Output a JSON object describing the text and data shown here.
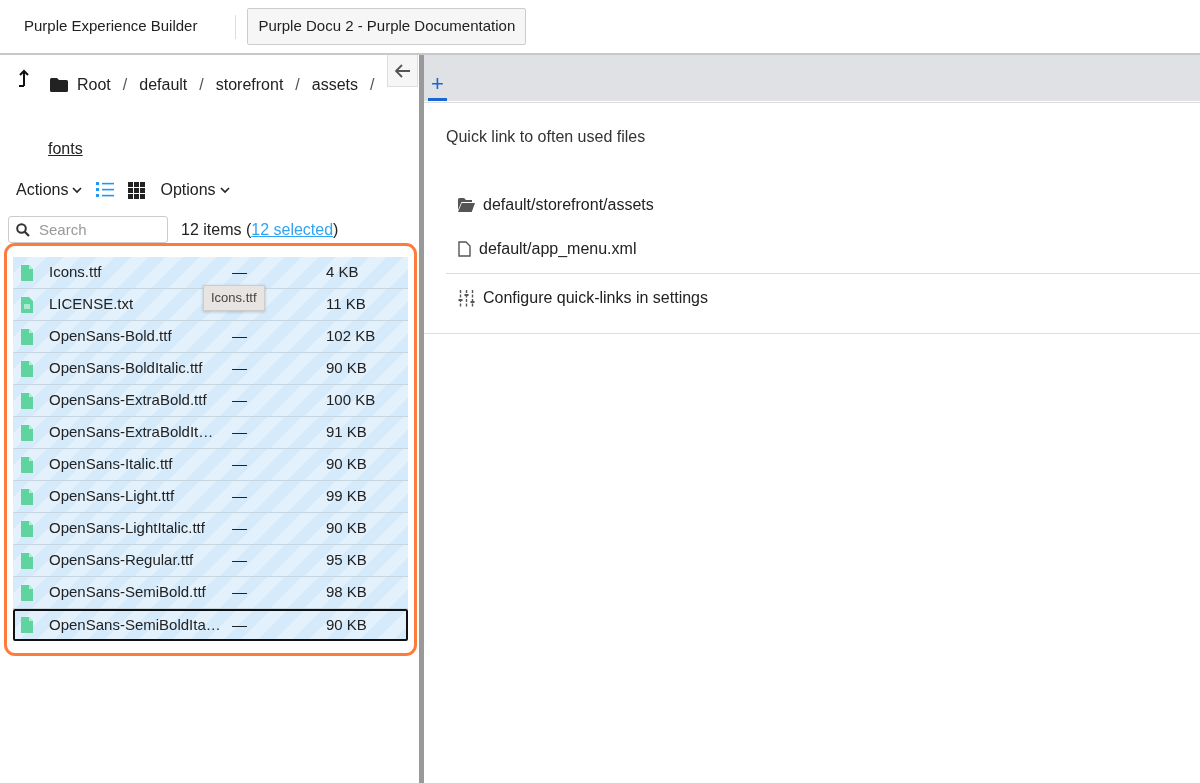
{
  "header": {
    "app_title": "Purple Experience Builder",
    "project_button": "Purple Docu 2 - Purple Documentation"
  },
  "breadcrumb": {
    "items": [
      {
        "label": "Root",
        "separator": "/"
      },
      {
        "label": "default",
        "separator": "/"
      },
      {
        "label": "storefront",
        "separator": "/"
      },
      {
        "label": "assets",
        "separator": "/"
      }
    ],
    "current": "fonts"
  },
  "toolbar": {
    "actions": "Actions",
    "view_modes": [
      {
        "kind": "list",
        "selected": true
      },
      {
        "kind": "grid",
        "selected": false
      }
    ],
    "options": "Options"
  },
  "search": {
    "placeholder": "Search"
  },
  "summary": {
    "count": "12 items",
    "open": "(",
    "selection": "12 selected",
    "close": ")"
  },
  "files": [
    {
      "name": "Icons.ttf",
      "status": "—",
      "size": "4 KB",
      "kind": "font",
      "selected": true,
      "focused": false
    },
    {
      "name": "LICENSE.txt",
      "size": "11 KB",
      "kind": "text",
      "selected": true,
      "focused": false
    },
    {
      "name": "OpenSans-Bold.ttf",
      "status": "—",
      "size": "102 KB",
      "kind": "font",
      "selected": true,
      "focused": false
    },
    {
      "name": "OpenSans-BoldItalic.ttf",
      "status": "—",
      "size": "90 KB",
      "kind": "font",
      "selected": true,
      "focused": false
    },
    {
      "name": "OpenSans-ExtraBold.ttf",
      "status": "—",
      "size": "100 KB",
      "kind": "font",
      "selected": true,
      "focused": false
    },
    {
      "name": "OpenSans-ExtraBoldIt…",
      "status": "—",
      "size": "91 KB",
      "kind": "font",
      "selected": true,
      "focused": false
    },
    {
      "name": "OpenSans-Italic.ttf",
      "status": "—",
      "size": "90 KB",
      "kind": "font",
      "selected": true,
      "focused": false
    },
    {
      "name": "OpenSans-Light.ttf",
      "status": "—",
      "size": "99 KB",
      "kind": "font",
      "selected": true,
      "focused": false
    },
    {
      "name": "OpenSans-LightItalic.ttf",
      "status": "—",
      "size": "90 KB",
      "kind": "font",
      "selected": true,
      "focused": false
    },
    {
      "name": "OpenSans-Regular.ttf",
      "status": "—",
      "size": "95 KB",
      "kind": "font",
      "selected": true,
      "focused": false
    },
    {
      "name": "OpenSans-SemiBold.ttf",
      "status": "—",
      "size": "98 KB",
      "kind": "font",
      "selected": true,
      "focused": false
    },
    {
      "name": "OpenSans-SemiBoldIta…",
      "status": "—",
      "size": "90 KB",
      "kind": "font",
      "selected": true,
      "focused": true
    }
  ],
  "tooltip": {
    "text": "Icons.ttf"
  },
  "tabs": [
    {
      "label": "+",
      "selected": true
    }
  ],
  "quick_links": {
    "title": "Quick link to often used files",
    "links": [
      {
        "kind": "folder",
        "label": "default/storefront/assets"
      },
      {
        "kind": "file",
        "label": "default/app_menu.xml"
      }
    ],
    "settings_link": "Configure quick-links in settings"
  }
}
